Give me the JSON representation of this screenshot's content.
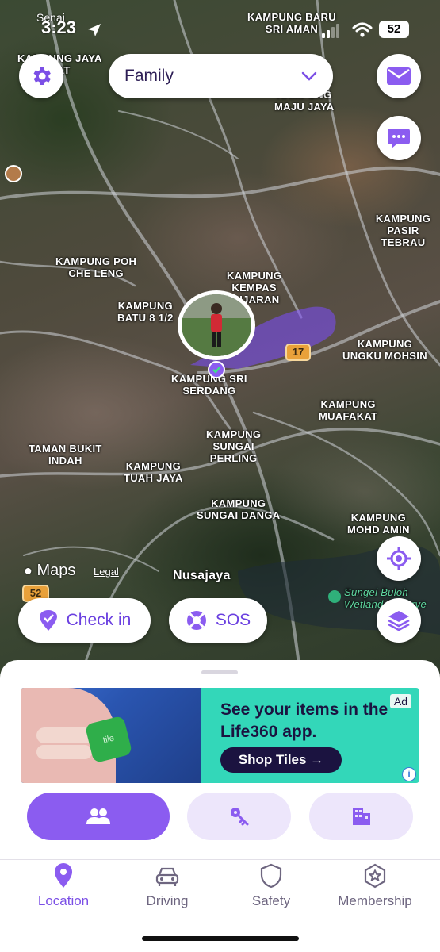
{
  "status_bar": {
    "carrier": "Senai",
    "time": "3:23",
    "battery": "52"
  },
  "header": {
    "circle_name": "Family"
  },
  "map": {
    "labels": [
      "KAMPUNG BARU\nSRI AMAN",
      "KAMPUNG JAYA\nKAT",
      "KAMPUNG\nMAJU JAYA",
      "KAMPUNG\nPASIR TEBRAU",
      "KAMPUNG POH\nCHE LENG",
      "KAMPUNG\nKEMPAS\nJUJARAN",
      "KAMPUNG\nBATU 8 1/2",
      "KAMPUNG\nUNGKU MOHSIN",
      "KAMPUNG SRI\nSERDANG",
      "KAMPUNG\nMUAFAKAT",
      "KAMPUNG\nSUNGAI\nPERLING",
      "TAMAN BUKIT\nINDAH",
      "KAMPUNG\nTUAH JAYA",
      "KAMPUNG\nSUNGAI DANGA",
      "KAMPUNG\nMOHD AMIN",
      "Nusajaya",
      "Sungei Buloh\nWetland Reserve"
    ],
    "route_badges": [
      "17",
      "52"
    ],
    "attribution": {
      "brand": "Maps",
      "legal": "Legal"
    }
  },
  "actions": {
    "check_in": "Check in",
    "sos": "SOS"
  },
  "ad": {
    "headline": "See your items in the Life360 app.",
    "cta": "Shop Tiles →",
    "tag": "Ad",
    "info": "i",
    "photo_text": "tile"
  },
  "tabs": [
    {
      "label": "Location",
      "icon": "location-pin-icon"
    },
    {
      "label": "Driving",
      "icon": "car-icon"
    },
    {
      "label": "Safety",
      "icon": "shield-icon"
    },
    {
      "label": "Membership",
      "icon": "star-badge-icon"
    }
  ],
  "colors": {
    "accent": "#8b5cf0",
    "accent_light": "#ede6fb",
    "ad_bg": "#33d7b9",
    "dark_navy": "#1b1340"
  }
}
